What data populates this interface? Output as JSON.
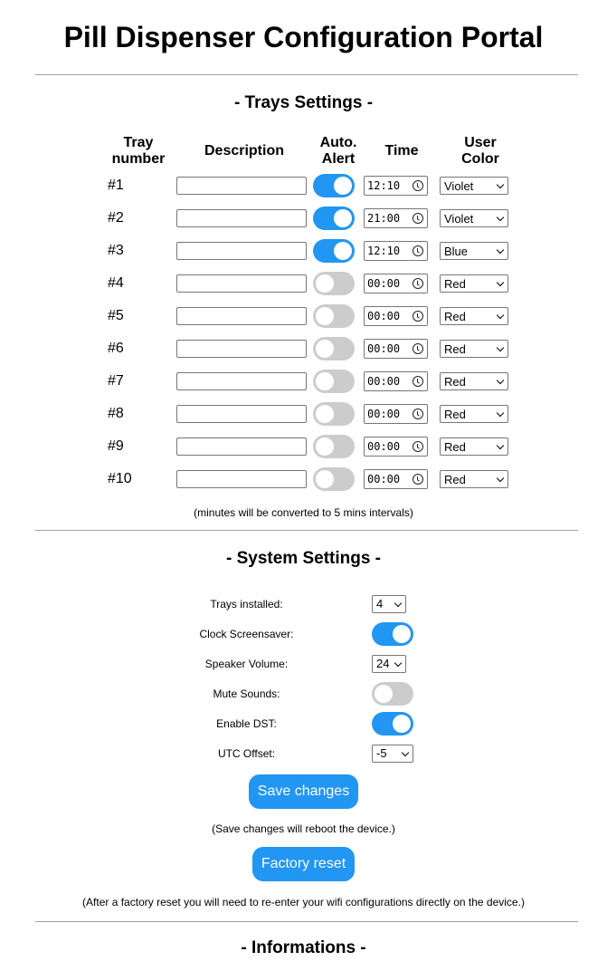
{
  "page": {
    "title": "Pill Dispenser Configuration Portal"
  },
  "trays": {
    "title": "- Trays Settings -",
    "headers": {
      "number_l1": "Tray",
      "number_l2": "number",
      "description": "Description",
      "alert_l1": "Auto.",
      "alert_l2": "Alert",
      "time": "Time",
      "color_l1": "User",
      "color_l2": "Color"
    },
    "rows": [
      {
        "number": "#1",
        "description": "",
        "auto_alert": true,
        "time": "12:10",
        "color": "Violet"
      },
      {
        "number": "#2",
        "description": "",
        "auto_alert": true,
        "time": "21:00",
        "color": "Violet"
      },
      {
        "number": "#3",
        "description": "",
        "auto_alert": true,
        "time": "12:10",
        "color": "Blue"
      },
      {
        "number": "#4",
        "description": "",
        "auto_alert": false,
        "time": "00:00",
        "color": "Red"
      },
      {
        "number": "#5",
        "description": "",
        "auto_alert": false,
        "time": "00:00",
        "color": "Red"
      },
      {
        "number": "#6",
        "description": "",
        "auto_alert": false,
        "time": "00:00",
        "color": "Red"
      },
      {
        "number": "#7",
        "description": "",
        "auto_alert": false,
        "time": "00:00",
        "color": "Red"
      },
      {
        "number": "#8",
        "description": "",
        "auto_alert": false,
        "time": "00:00",
        "color": "Red"
      },
      {
        "number": "#9",
        "description": "",
        "auto_alert": false,
        "time": "00:00",
        "color": "Red"
      },
      {
        "number": "#10",
        "description": "",
        "auto_alert": false,
        "time": "00:00",
        "color": "Red"
      }
    ],
    "note": "(minutes will be converted to 5 mins intervals)"
  },
  "system": {
    "title": "- System Settings -",
    "trays_installed": {
      "label": "Trays installed:",
      "value": "4"
    },
    "clock_screensaver": {
      "label": "Clock Screensaver:",
      "on": true
    },
    "speaker_volume": {
      "label": "Speaker Volume:",
      "value": "24"
    },
    "mute_sounds": {
      "label": "Mute Sounds:",
      "on": false
    },
    "enable_dst": {
      "label": "Enable DST:",
      "on": true
    },
    "utc_offset": {
      "label": "UTC Offset:",
      "value": "-5"
    },
    "save_label": "Save changes",
    "save_note": "(Save changes will reboot the device.)",
    "reset_label": "Factory reset",
    "reset_note": "(After a factory reset you will need to re-enter your wifi configurations directly on the device.)"
  },
  "info": {
    "title": "- Informations -"
  },
  "colors": {
    "accent": "#2196f3",
    "toggle_off": "#cccccc",
    "separator": "#a0a0a0"
  }
}
